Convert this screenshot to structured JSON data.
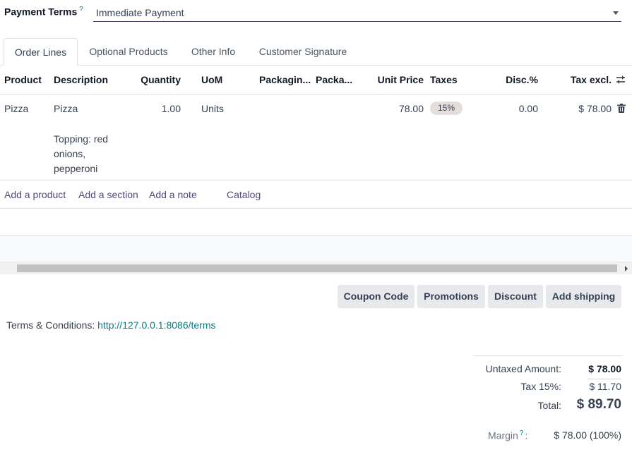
{
  "payment_terms": {
    "label": "Payment Terms",
    "help": "?",
    "value": "Immediate Payment"
  },
  "tabs": [
    "Order Lines",
    "Optional Products",
    "Other Info",
    "Customer Signature"
  ],
  "columns": [
    "Product",
    "Description",
    "Quantity",
    "UoM",
    "Packagin...",
    "Packa...",
    "Unit Price",
    "Taxes",
    "Disc.%",
    "Tax excl."
  ],
  "line": {
    "product": "Pizza",
    "description": "Pizza",
    "description_extra": "Topping: red onions, pepperoni",
    "quantity": "1.00",
    "uom": "Units",
    "unit_price": "78.00",
    "tax": "15%",
    "discount": "0.00",
    "subtotal": "$ 78.00"
  },
  "add_links": [
    "Add a product",
    "Add a section",
    "Add a note",
    "Catalog"
  ],
  "buttons": [
    "Coupon Code",
    "Promotions",
    "Discount",
    "Add shipping"
  ],
  "terms": {
    "label": "Terms & Conditions:",
    "link": "http://127.0.0.1:8086/terms"
  },
  "totals": {
    "untaxed_label": "Untaxed Amount:",
    "untaxed_value": "$ 78.00",
    "tax_label": "Tax 15%:",
    "tax_value": "$ 11.70",
    "total_label": "Total:",
    "total_value": "$ 89.70",
    "margin_label": "Margin",
    "margin_help": "?",
    "margin_colon": ":",
    "margin_value": "$ 78.00 (100%)"
  },
  "colors": {
    "accent": "#017e84",
    "link": "#4f4a7a",
    "button_bg": "#e7e9ed",
    "badge_bg": "#e5dcdc"
  }
}
